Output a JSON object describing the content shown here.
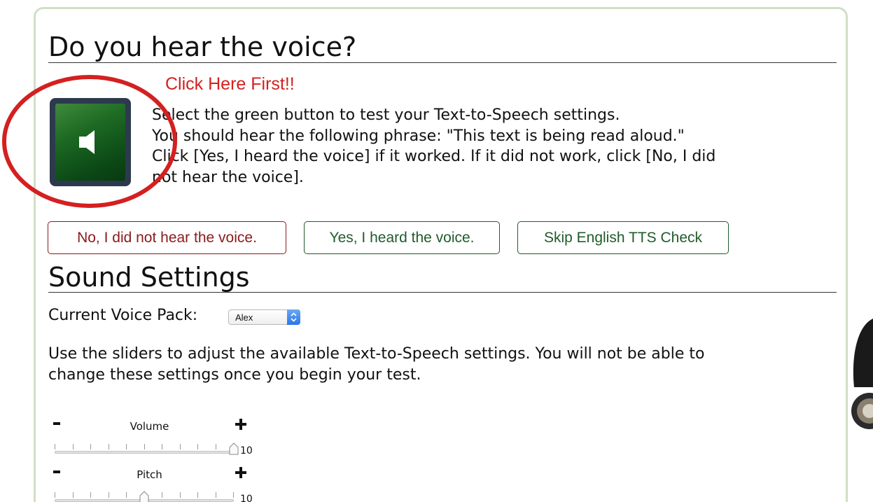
{
  "tts_check": {
    "title": "Do you hear the voice?",
    "click_here": "Click Here First!!",
    "instructions": [
      "Select the green button to test your Text-to-Speech settings.",
      "You should hear the following phrase: \"This text is being read aloud.\"",
      "Click [Yes, I heard the voice] if it worked. If it did not work, click [No, I did",
      "not hear the voice]."
    ],
    "buttons": {
      "no": "No, I did not hear the voice.",
      "yes": "Yes, I heard the voice.",
      "skip": "Skip English TTS Check"
    },
    "icons": {
      "speaker": "speaker-icon",
      "annotation": "red-circle-annotation"
    }
  },
  "sound_settings": {
    "title": "Sound Settings",
    "voice_pack_label": "Current Voice Pack:",
    "voice_pack_value": "Alex",
    "description": [
      "Use the sliders to adjust the available Text-to-Speech settings. You will not be able to",
      "change these settings once you begin your test."
    ],
    "sliders": [
      {
        "name": "volume",
        "label": "Volume",
        "value": "10",
        "level": 1.0,
        "minus": "-",
        "plus": "+"
      },
      {
        "name": "pitch",
        "label": "Pitch",
        "value": "10",
        "level": 0.5,
        "minus": "-",
        "plus": "+"
      }
    ]
  },
  "colors": {
    "annotation_red": "#d42020",
    "speaker_green": "#1e6b24",
    "negative_button": "#8a1a1a",
    "positive_button": "#1f5c2a",
    "panel_border": "#cfe0c3"
  }
}
